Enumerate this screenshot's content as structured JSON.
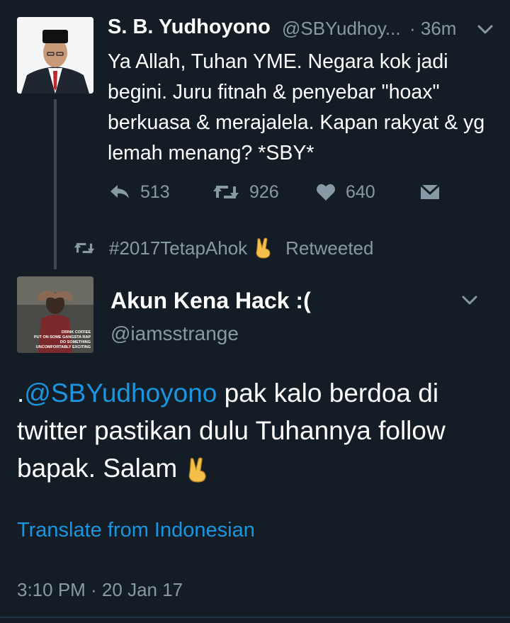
{
  "tweet1": {
    "name": "S. B. Yudhoyono",
    "handle": "@SBYudhoy...",
    "time": "· 36m",
    "text": "Ya Allah, Tuhan YME. Negara kok jadi begini. Juru fitnah & penyebar \"hoax\" berkuasa & merajalela. Kapan rakyat & yg lemah menang? *SBY*",
    "reply_count": "513",
    "retweet_count": "926",
    "like_count": "640"
  },
  "retweeted_by": {
    "name": "#2017TetapAhok",
    "label": "Retweeted"
  },
  "tweet2": {
    "name": "Akun Kena Hack :(",
    "handle": "@iamsstrange",
    "text_prefix": ".",
    "mention": "@SBYudhoyono",
    "text_body": " pak kalo berdoa di twitter pastikan dulu Tuhannya follow bapak. Salam ",
    "translate": "Translate from Indonesian",
    "timestamp": "3:10 PM · 20 Jan 17"
  },
  "avatar2_image_text": [
    "DRINK COFFEE",
    "PUT ON SOME GANGSTA RAP",
    "DO SOMETHING",
    "UNCOMFORTABLY EXCITING"
  ],
  "icons": [
    "reply-icon",
    "retweet-icon",
    "like-icon",
    "direct-message-icon",
    "chevron-down-icon",
    "victory-hand-emoji"
  ],
  "colors": {
    "background": "#141d26",
    "link": "#1b95e0",
    "secondary_text": "#8899a6"
  }
}
